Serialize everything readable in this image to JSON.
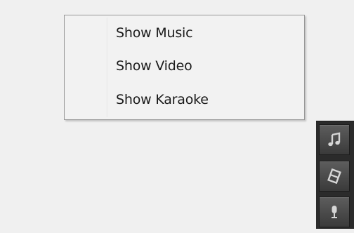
{
  "context_menu": {
    "items": [
      {
        "label": "Show Music"
      },
      {
        "label": "Show Video"
      },
      {
        "label": "Show Karaoke"
      }
    ]
  },
  "mode_toolbar": {
    "buttons": [
      {
        "icon": "music-note-icon"
      },
      {
        "icon": "film-icon"
      },
      {
        "icon": "microphone-icon"
      }
    ],
    "icon_color": "#d6d6d6",
    "background_color": "#2b2b2b"
  }
}
